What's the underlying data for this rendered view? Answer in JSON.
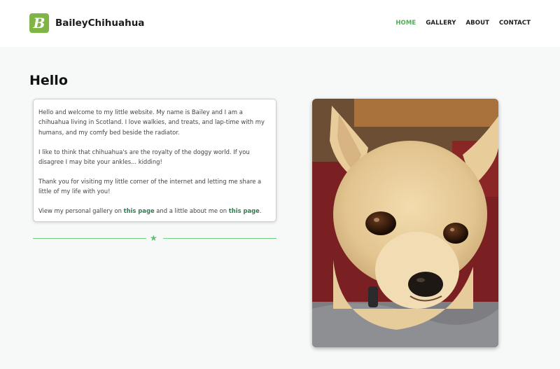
{
  "site": {
    "logo_letter": "B",
    "name": "BaileyChihuahua"
  },
  "nav": {
    "items": [
      {
        "label": "HOME",
        "active": true
      },
      {
        "label": "GALLERY",
        "active": false
      },
      {
        "label": "ABOUT",
        "active": false
      },
      {
        "label": "CONTACT",
        "active": false
      }
    ]
  },
  "main": {
    "heading": "Hello",
    "paragraphs": [
      "Hello and welcome to my little website. My name is Bailey and I am a chihuahua living in Scotland. I love walkies, and treats, and lap-time with my humans, and my comfy bed beside the radiator.",
      "I like to think that chihuahua's are the royalty of the doggy world. If you disagree I may bite your ankles... kidding!",
      "Thank you for visiting my little corner of the internet and letting me share a little of my life with you!"
    ],
    "links_line": {
      "prefix": "View my personal gallery on ",
      "link1": "this page",
      "middle": " and a little about me on ",
      "link2": "this page",
      "suffix": "."
    }
  },
  "colors": {
    "accent": "#4caf50",
    "logo_bg": "#7fb545",
    "link": "#2e7d4f",
    "divider": "#6fcf80"
  },
  "icons": {
    "divider": "star-icon"
  }
}
